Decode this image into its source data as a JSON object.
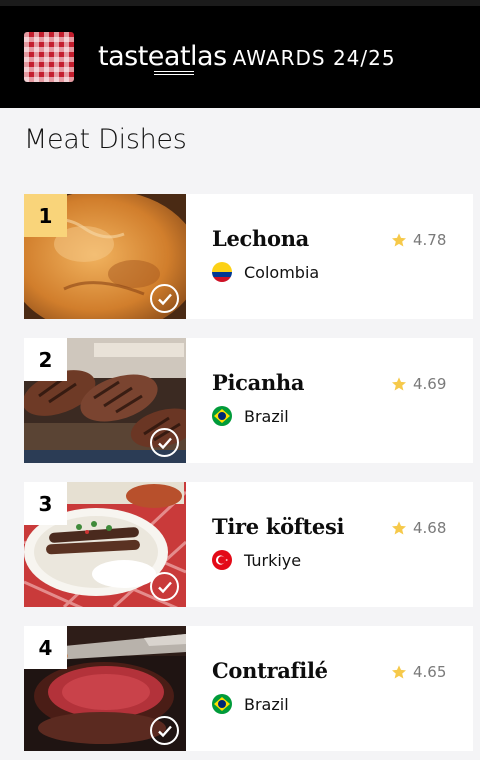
{
  "header": {
    "brand_taste": "tasteatlas",
    "brand_awards": "AWARDS 24/25"
  },
  "page_title": "Meat Dishes",
  "dishes": [
    {
      "rank": "1",
      "name": "Lechona",
      "country": "Colombia",
      "rating": "4.78"
    },
    {
      "rank": "2",
      "name": "Picanha",
      "country": "Brazil",
      "rating": "4.69"
    },
    {
      "rank": "3",
      "name": "Tire köftesi",
      "country": "Turkiye",
      "rating": "4.68"
    },
    {
      "rank": "4",
      "name": "Contrafilé",
      "country": "Brazil",
      "rating": "4.65"
    }
  ],
  "colors": {
    "rank_highlight": "#f9d47a",
    "star": "#f6c94a",
    "header_bg": "#000000"
  },
  "icons": {
    "logo": "tablecloth-logo-icon",
    "rating": "star-icon",
    "tried": "check-circle-icon"
  }
}
